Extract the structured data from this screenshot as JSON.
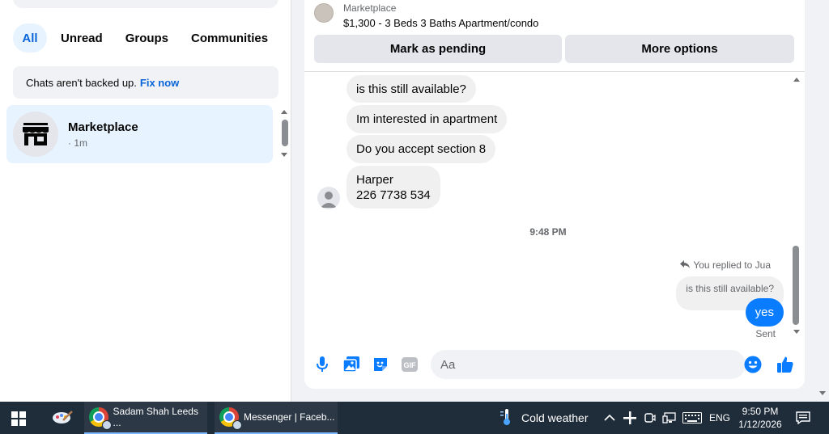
{
  "sidebar": {
    "filters": [
      {
        "label": "All",
        "active": true
      },
      {
        "label": "Unread",
        "active": false
      },
      {
        "label": "Groups",
        "active": false
      },
      {
        "label": "Communities",
        "active": false
      }
    ],
    "notice": {
      "text": "Chats aren't backed up.",
      "link": "Fix now"
    },
    "chats": [
      {
        "name": "Marketplace",
        "time": "· 1m",
        "icon": "storefront-icon"
      }
    ]
  },
  "conversation": {
    "listing": {
      "label": "Marketplace",
      "title": "$1,300 - 3 Beds 3 Baths Apartment/condo"
    },
    "buttons": {
      "pending": "Mark as pending",
      "more": "More options"
    },
    "messages": [
      {
        "text": "is this still available?"
      },
      {
        "text": "Im interested in apartment"
      },
      {
        "text": "Do you accept section 8"
      },
      {
        "line1": "Harper",
        "line2": "226 7738 534"
      }
    ],
    "time_separator": "9:48 PM",
    "reply": {
      "note": "You replied to Jua",
      "quoted": "is this still available?",
      "text": "yes",
      "status": "Sent"
    },
    "composer": {
      "placeholder": "Aa"
    },
    "accent": "#0a7cff"
  },
  "taskbar": {
    "apps": [
      {
        "label": "Sadam Shah Leeds ..."
      },
      {
        "label": "Messenger | Faceb..."
      }
    ],
    "weather": "Cold weather",
    "language": "ENG",
    "time": "9:50 PM",
    "date": "1/12/2026"
  }
}
